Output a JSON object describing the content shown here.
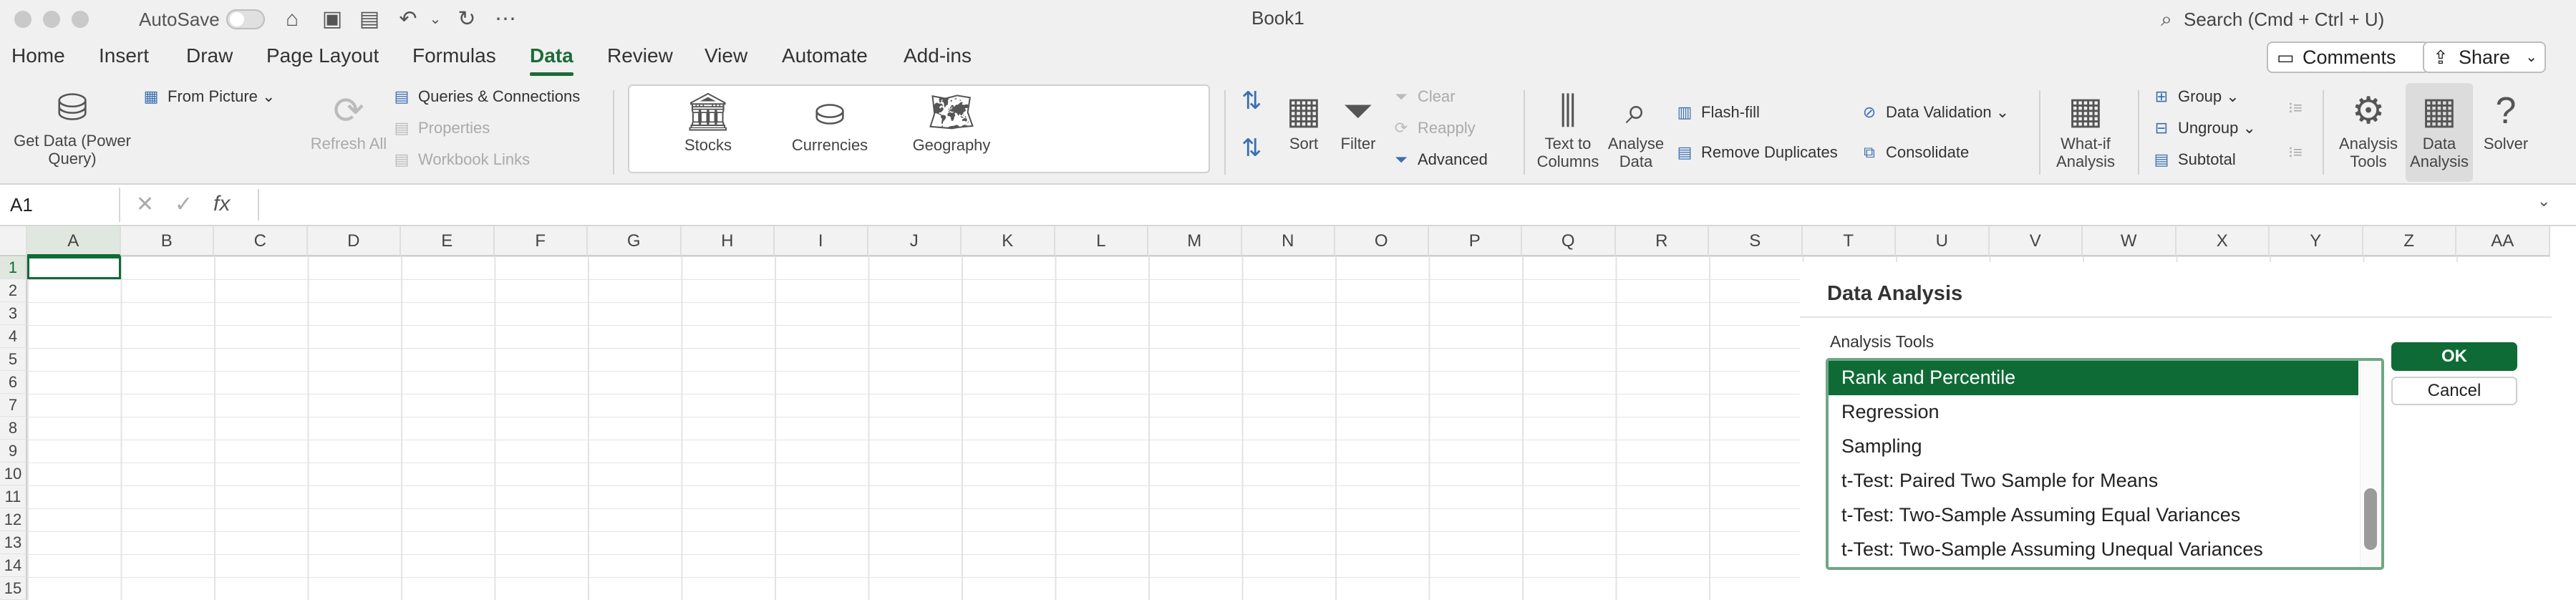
{
  "titlebar": {
    "autosave_label": "AutoSave",
    "title": "Book1",
    "search_placeholder": "Search (Cmd + Ctrl + U)"
  },
  "menu": {
    "tabs": [
      "Home",
      "Insert",
      "Draw",
      "Page Layout",
      "Formulas",
      "Data",
      "Review",
      "View",
      "Automate",
      "Add-ins"
    ],
    "active_tab": "Data",
    "comments_label": "Comments",
    "share_label": "Share"
  },
  "ribbon": {
    "get_data": "Get Data (Power Query)",
    "from_picture": "From Picture",
    "refresh_all": "Refresh All",
    "queries_connections": "Queries & Connections",
    "properties": "Properties",
    "workbook_links": "Workbook Links",
    "data_types": [
      "Stocks",
      "Currencies",
      "Geography"
    ],
    "sort": "Sort",
    "filter": "Filter",
    "clear": "Clear",
    "reapply": "Reapply",
    "advanced": "Advanced",
    "text_to_columns": "Text to Columns",
    "analyse_data": "Analyse Data",
    "flash_fill": "Flash-fill",
    "remove_duplicates": "Remove Duplicates",
    "data_validation": "Data Validation",
    "consolidate": "Consolidate",
    "what_if": "What-if Analysis",
    "group": "Group",
    "ungroup": "Ungroup",
    "subtotal": "Subtotal",
    "analysis_tools": "Analysis Tools",
    "data_analysis": "Data Analysis",
    "solver": "Solver"
  },
  "formula_bar": {
    "name_box": "A1",
    "fx": "fx",
    "formula": ""
  },
  "sheet": {
    "columns": [
      "A",
      "B",
      "C",
      "D",
      "E",
      "F",
      "G",
      "H",
      "I",
      "J",
      "K",
      "L",
      "M",
      "N",
      "O",
      "P",
      "Q",
      "R",
      "S",
      "T",
      "U",
      "V",
      "W",
      "X",
      "Y",
      "Z",
      "AA"
    ],
    "rows": [
      "1",
      "2",
      "3",
      "4",
      "5",
      "6",
      "7",
      "8",
      "9",
      "10",
      "11",
      "12",
      "13",
      "14",
      "15"
    ],
    "active_cell": "A1"
  },
  "dialog": {
    "title": "Data Analysis",
    "list_label": "Analysis Tools",
    "items": [
      "Rank and Percentile",
      "Regression",
      "Sampling",
      "t-Test: Paired Two Sample for Means",
      "t-Test: Two-Sample Assuming Equal Variances",
      "t-Test: Two-Sample Assuming Unequal Variances"
    ],
    "selected_item": "Rank and Percentile",
    "ok_label": "OK",
    "cancel_label": "Cancel"
  },
  "colors": {
    "accent": "#0f6b36",
    "accent_border": "#6fa784",
    "chrome_bg": "#f0f0f0"
  }
}
